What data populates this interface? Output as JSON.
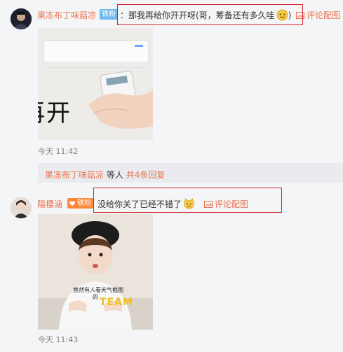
{
  "colors": {
    "username": "#eb7350",
    "badge_bg": "#6fb9ef",
    "red_box": "#d2232a",
    "time": "#808080"
  },
  "comment1": {
    "username": "果冻布丁味菇凉",
    "badge": "铁粉",
    "text": "：那我再给你开开呀(哥，筹备还有多久哇",
    "text_tail": ")",
    "image_caption": "再开",
    "action": "评论配图",
    "time": "今天 11:42"
  },
  "replies_bar": {
    "user": "果冻布丁味菇凉",
    "middle": "等人",
    "count": "共4条回复"
  },
  "comment2": {
    "username": "陽櫻涵",
    "badge": "铁粉",
    "text": "没给你关了已经不错了",
    "action": "评论配图",
    "image_caption_line1": "竟然有人看天气截图",
    "image_caption_line2": "的",
    "image_shirt_text": "TEAM",
    "time": "今天 11:43"
  }
}
